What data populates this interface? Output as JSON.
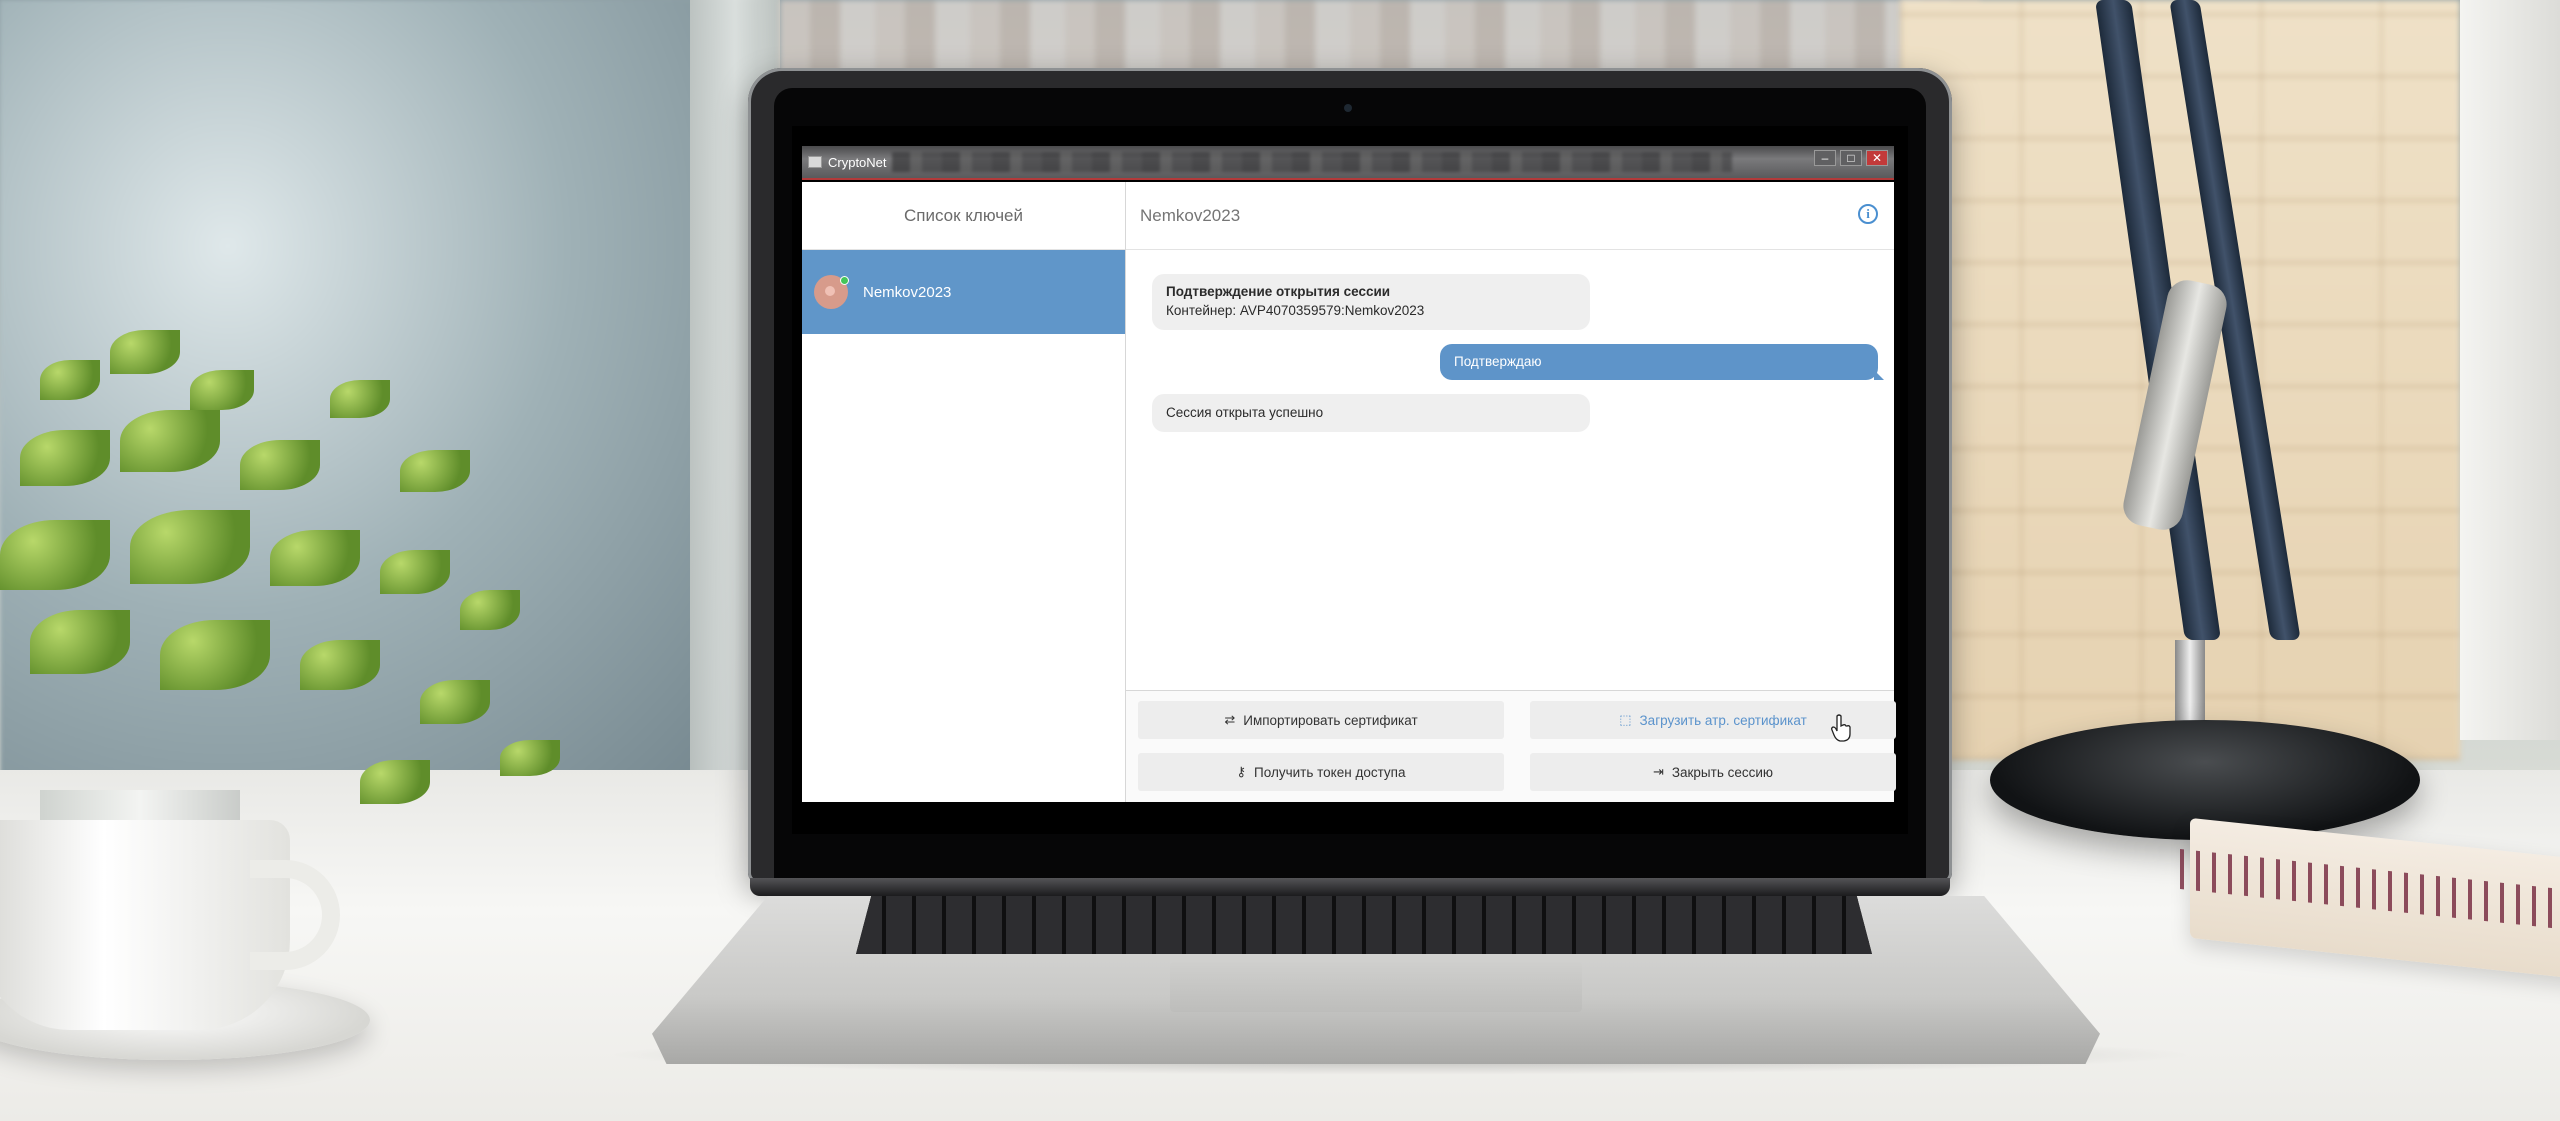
{
  "app": {
    "window_title": "CryptoNet",
    "window_buttons": {
      "minimize": "–",
      "maximize": "□",
      "close": "✕"
    }
  },
  "sidebar": {
    "header": "Список ключей",
    "items": [
      {
        "name": "Nemkov2023",
        "status": "online",
        "selected": true
      }
    ]
  },
  "chat": {
    "title": "Nemkov2023",
    "info_icon": "info-icon",
    "messages": [
      {
        "direction": "in",
        "title": "Подтверждение открытия сессии",
        "text": "Контейнер: AVP4070359579:Nemkov2023"
      },
      {
        "direction": "out",
        "text": "Подтверждаю"
      },
      {
        "direction": "in",
        "text": "Сессия открыта успешно"
      }
    ]
  },
  "actions": [
    {
      "label": "Импортировать сертификат",
      "icon": "import-icon"
    },
    {
      "label": "Загрузить атр. сертификат",
      "icon": "upload-icon",
      "highlighted": true
    },
    {
      "label": "Получить токен доступа",
      "icon": "key-icon"
    },
    {
      "label": "Закрыть сессию",
      "icon": "close-session-icon"
    }
  ],
  "colors": {
    "accent": "#6096c9",
    "message_out": "#5e94c9",
    "message_in": "#efefef",
    "online": "#44c55a"
  }
}
